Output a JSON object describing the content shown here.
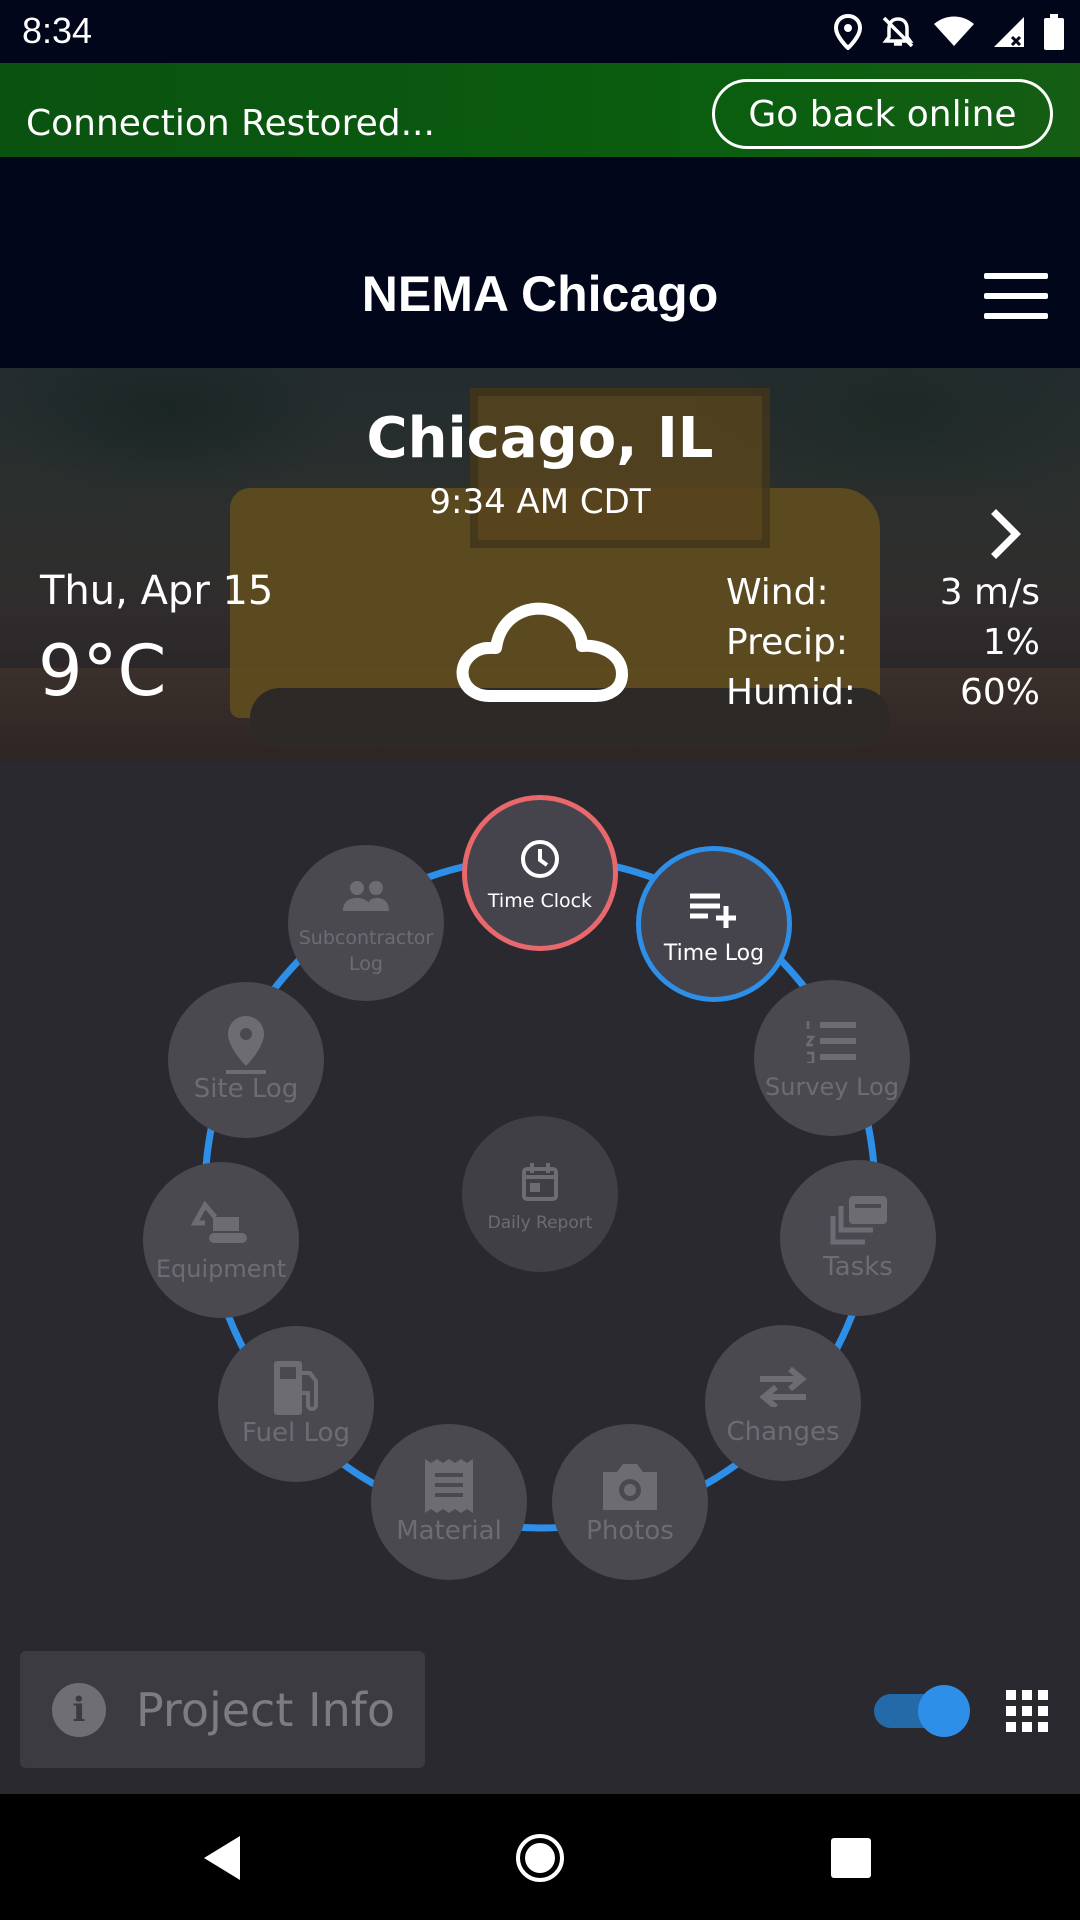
{
  "status_bar": {
    "time": "8:34",
    "icons": [
      "location-icon",
      "notifications-off-icon",
      "wifi-icon",
      "cell-signal-icon",
      "battery-icon"
    ]
  },
  "banner": {
    "text": "Connection Restored...",
    "button_label": "Go back online",
    "color": "#0b5e0f"
  },
  "header": {
    "title": "NEMA Chicago",
    "menu_icon": "hamburger-icon"
  },
  "weather": {
    "city": "Chicago, IL",
    "local_time": "9:34 AM CDT",
    "date": "Thu, Apr 15",
    "temperature": "9°C",
    "condition_icon": "cloud-icon",
    "stats": [
      {
        "label": "Wind:",
        "value": "3 m/s"
      },
      {
        "label": "Precip:",
        "value": "1%"
      },
      {
        "label": "Humid:",
        "value": "60%"
      }
    ]
  },
  "hub": {
    "center": {
      "label": "Daily Report",
      "icon": "calendar-icon"
    },
    "items": [
      {
        "label": "Time Clock",
        "icon": "clock-icon",
        "active": true,
        "ring_color": "#e8686c"
      },
      {
        "label": "Time Log",
        "icon": "playlist-add-icon",
        "active": true,
        "ring_color": "#2e8fe9"
      },
      {
        "label": "Survey Log",
        "icon": "numbered-list-icon",
        "active": false
      },
      {
        "label": "Tasks",
        "icon": "layers-icon",
        "active": false
      },
      {
        "label": "Changes",
        "icon": "swap-arrows-icon",
        "active": false
      },
      {
        "label": "Photos",
        "icon": "camera-icon",
        "active": false
      },
      {
        "label": "Material",
        "icon": "receipt-icon",
        "active": false
      },
      {
        "label": "Fuel Log",
        "icon": "fuel-pump-icon",
        "active": false
      },
      {
        "label": "Equipment",
        "icon": "excavator-icon",
        "active": false
      },
      {
        "label": "Site Log",
        "icon": "map-pin-icon",
        "active": false
      },
      {
        "label": "Subcontractor Log",
        "icon": "people-icon",
        "active": false
      }
    ],
    "ring_color": "#2e8fe9"
  },
  "footer": {
    "project_info_label": "Project Info",
    "toggle_on": true,
    "grid_icon": "grid-icon"
  },
  "nav": {
    "back": "back-icon",
    "home": "home-icon",
    "recents": "recents-icon"
  }
}
